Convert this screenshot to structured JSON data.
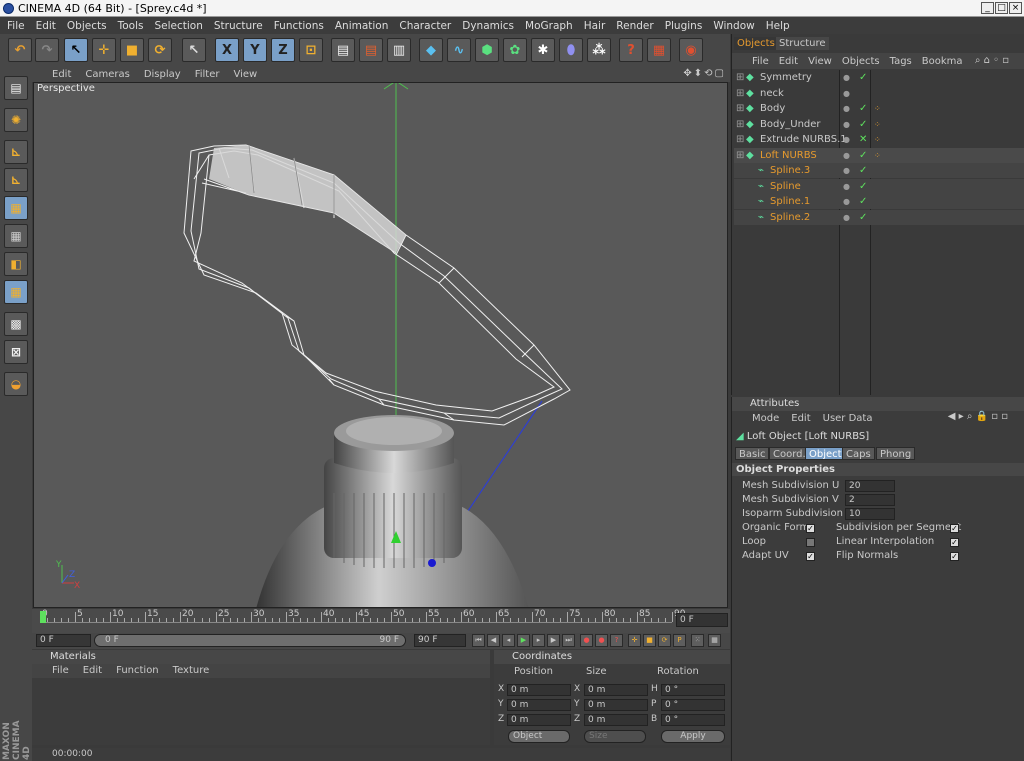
{
  "window": {
    "title": "CINEMA 4D (64 Bit) - [Sprey.c4d *]"
  },
  "menu": [
    "File",
    "Edit",
    "Objects",
    "Tools",
    "Selection",
    "Structure",
    "Functions",
    "Animation",
    "Character",
    "Dynamics",
    "MoGraph",
    "Hair",
    "Render",
    "Plugins",
    "Window",
    "Help"
  ],
  "toolbar": {
    "x_label": "X",
    "y_label": "Y",
    "z_label": "Z",
    "help_label": "?"
  },
  "viewport": {
    "menu": [
      "Edit",
      "Cameras",
      "Display",
      "Filter",
      "View"
    ],
    "name": "Perspective",
    "axis_x": "X",
    "axis_y": "Y",
    "axis_z": "Z"
  },
  "timeline": {
    "ticks": [
      "0",
      "5",
      "10",
      "15",
      "20",
      "25",
      "30",
      "35",
      "40",
      "45",
      "50",
      "55",
      "60",
      "65",
      "70",
      "75",
      "80",
      "85",
      "90"
    ],
    "current_frame": "0 F"
  },
  "transport": {
    "start": "0 F",
    "slider_left": "0 F",
    "slider_right": "90 F",
    "end": "90 F"
  },
  "materials": {
    "title": "Materials",
    "menu": [
      "File",
      "Edit",
      "Function",
      "Texture"
    ]
  },
  "coordinates": {
    "title": "Coordinates",
    "headers": [
      "Position",
      "Size",
      "Rotation"
    ],
    "rows": [
      {
        "axis": "X",
        "pos": "0 m",
        "saxis": "X",
        "size": "0 m",
        "raxis": "H",
        "rot": "0 °"
      },
      {
        "axis": "Y",
        "pos": "0 m",
        "saxis": "Y",
        "size": "0 m",
        "raxis": "P",
        "rot": "0 °"
      },
      {
        "axis": "Z",
        "pos": "0 m",
        "saxis": "Z",
        "size": "0 m",
        "raxis": "B",
        "rot": "0 °"
      }
    ],
    "mode": "Object",
    "size_mode": "Size",
    "apply": "Apply"
  },
  "status": {
    "time": "00:00:00"
  },
  "objects": {
    "tabs": [
      "Objects",
      "Structure"
    ],
    "menu": [
      "File",
      "Edit",
      "View",
      "Objects",
      "Tags",
      "Bookma"
    ],
    "items": [
      {
        "name": "Symmetry",
        "color": "#c9c9c9"
      },
      {
        "name": "neck",
        "color": "#c9c9c9"
      },
      {
        "name": "Body",
        "color": "#c9c9c9"
      },
      {
        "name": "Body_Under",
        "color": "#c9c9c9"
      },
      {
        "name": "Extrude NURBS.1",
        "color": "#c9c9c9"
      },
      {
        "name": "Loft NURBS",
        "color": "#e69a2e"
      },
      {
        "name": "Spline.3",
        "color": "#e69a2e"
      },
      {
        "name": "Spline",
        "color": "#e69a2e"
      },
      {
        "name": "Spline.1",
        "color": "#e69a2e"
      },
      {
        "name": "Spline.2",
        "color": "#e69a2e"
      }
    ]
  },
  "attributes": {
    "title": "Attributes",
    "menu": [
      "Mode",
      "Edit",
      "User Data"
    ],
    "object_title": "Loft Object [Loft NURBS]",
    "tabs": [
      "Basic",
      "Coord.",
      "Object",
      "Caps",
      "Phong"
    ],
    "section": "Object Properties",
    "mesh_u_label": "Mesh Subdivision U",
    "mesh_u": "20",
    "mesh_v_label": "Mesh Subdivision V",
    "mesh_v": "2",
    "iso_u_label": "Isoparm Subdivision U",
    "iso_u": "10",
    "organic": "Organic Form",
    "subdiv_seg": "Subdivision per Segment",
    "loop": "Loop",
    "linear": "Linear Interpolation",
    "adapt": "Adapt UV",
    "flip": "Flip Normals"
  }
}
